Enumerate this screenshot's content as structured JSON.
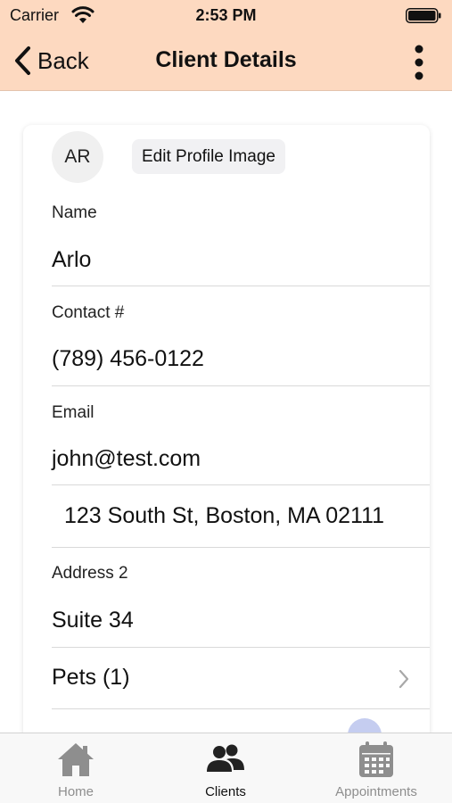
{
  "status_bar": {
    "carrier": "Carrier",
    "time": "2:53 PM"
  },
  "nav": {
    "back_label": "Back",
    "title": "Client Details"
  },
  "profile": {
    "initials": "AR",
    "edit_image_label": "Edit Profile Image"
  },
  "fields": {
    "name": {
      "label": "Name",
      "value": "Arlo"
    },
    "contact": {
      "label": "Contact #",
      "value": "(789) 456-0122"
    },
    "email": {
      "label": "Email",
      "value": "john@test.com"
    },
    "address1": {
      "value": "123 South St, Boston, MA 02111"
    },
    "address2": {
      "label": "Address 2",
      "value": "Suite 34"
    }
  },
  "pets": {
    "label": "Pets (1)"
  },
  "tabbar": {
    "tabs": [
      {
        "label": "Home",
        "icon": "home-icon",
        "active": false
      },
      {
        "label": "Clients",
        "icon": "clients-icon",
        "active": true
      },
      {
        "label": "Appointments",
        "icon": "calendar-icon",
        "active": false
      }
    ]
  },
  "colors": {
    "header_bg": "#fdd9c0",
    "inactive_tab": "#8e8e8e",
    "active_tab": "#111111"
  }
}
